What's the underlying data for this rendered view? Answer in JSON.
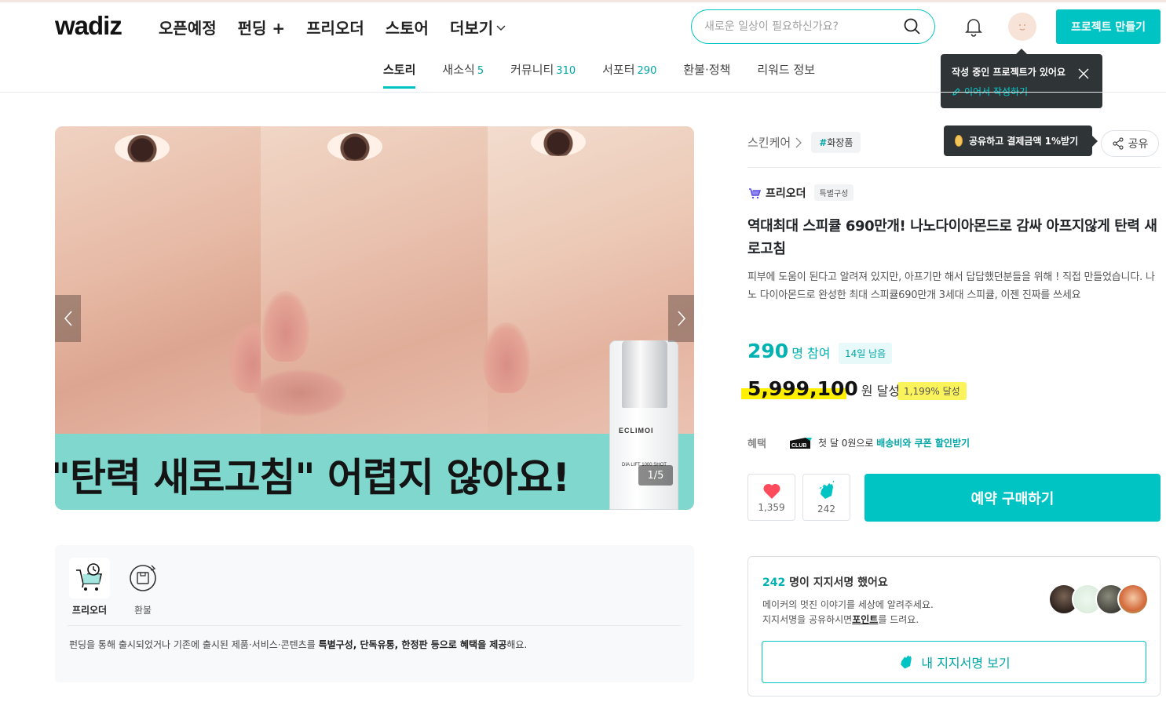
{
  "header": {
    "logo": "wadiz",
    "nav": [
      {
        "label": "오픈예정"
      },
      {
        "label": "펀딩 +"
      },
      {
        "label": "프리오더"
      },
      {
        "label": "스토어"
      },
      {
        "label": "더보기"
      }
    ],
    "search_placeholder": "새로운 일상이 필요하신가요?",
    "make_project": "프로젝트 만들기"
  },
  "draft_tooltip": {
    "title": "작성 중인 프로젝트가 있어요",
    "action": "이어서 작성하기"
  },
  "tabs": [
    {
      "label": "스토리",
      "count": ""
    },
    {
      "label": "새소식",
      "count": "5"
    },
    {
      "label": "커뮤니티",
      "count": "310"
    },
    {
      "label": "서포터",
      "count": "290"
    },
    {
      "label": "환불·정책",
      "count": ""
    },
    {
      "label": "리워드 정보",
      "count": ""
    }
  ],
  "hero": {
    "banner_text": "\"탄력 새로고침\" 어렵지 않아요!",
    "counter": "1/5",
    "bottle_brand": "ECLIMOI",
    "bottle_sub": "DIA LIFT 1000 SHOT"
  },
  "info_box": {
    "badges": [
      {
        "label": "프리오더"
      },
      {
        "label": "환불"
      }
    ],
    "desc_prefix": "펀딩을 통해 출시되었거나 기존에 출시된 제품·서비스·콘텐츠를 ",
    "desc_bold1": "특별구성",
    "desc_sep1": ", ",
    "desc_bold2": "단독유통",
    "desc_sep2": ", ",
    "desc_bold3": "한정판 등으로 혜택을 제공",
    "desc_suffix": "해요."
  },
  "product": {
    "category": "스킨케어",
    "tag": "화장품",
    "share_tip": "공유하고 결제금액 1%받기",
    "share_label": "공유",
    "preorder_label": "프리오더",
    "special_label": "특별구성",
    "title": "역대최대 스피큘 690만개! 나노다이아몬드로 감싸 아프지않게 탄력 새로고침",
    "description": "피부에 도움이 된다고 알려져 있지만, 아프기만 해서 답답했던분들을 위해 ! 직접 만들었습니다. 나노 다이아몬드로 완성한 최대 스피큘690만개 3세대 스피큘, 이젠 진짜를 쓰세요",
    "supporters": "290",
    "supporters_unit": "명 참여",
    "days_left": "14일 남음",
    "amount": "5,999,100",
    "amount_unit": "원 달성",
    "percent": "1,199% 달성",
    "benefit_label": "혜택",
    "club_label": "CLUB",
    "benefit_prefix": "첫 달 0원으로 ",
    "benefit_highlight": "배송비와 쿠폰 할인받기",
    "likes": "1,359",
    "claps": "242",
    "buy_label": "예약 구매하기"
  },
  "signature": {
    "count": "242",
    "title_suffix": " 명이 지지서명 했어요",
    "line1": "메이커의 멋진 이야기를 세상에 알려주세요.",
    "line2_prefix": "지지서명을 공유하시면",
    "line2_bold": "포인트",
    "line2_suffix": "를 드려요.",
    "button": "내 지지서명 보기"
  },
  "colors": {
    "accent": "#00c4c4",
    "highlight": "#fff000",
    "tooltip_bg": "#2f3437"
  }
}
